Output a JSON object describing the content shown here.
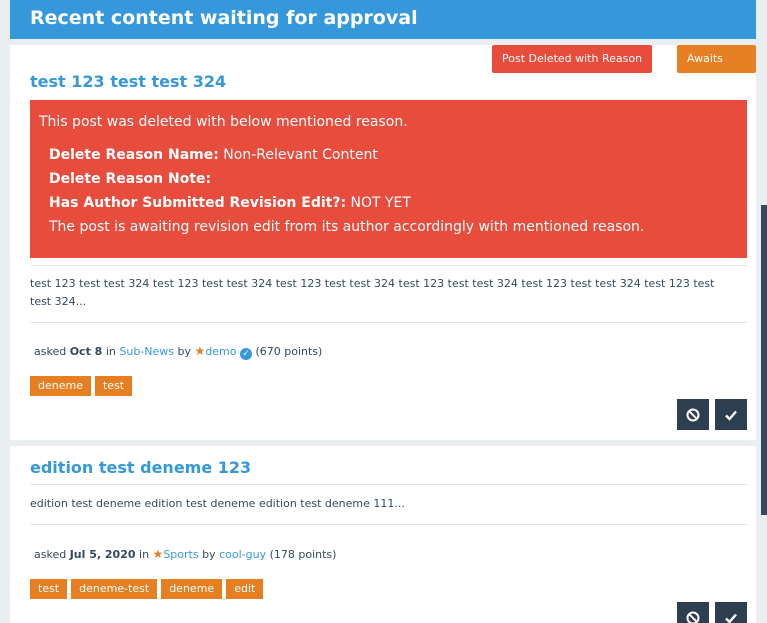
{
  "page": {
    "title": "Recent content waiting for approval"
  },
  "questions": [
    {
      "title": "test 123 test test 324",
      "badges": {
        "deleted": "Post Deleted with Reason",
        "awaits": "Awaits Edit"
      },
      "alert": {
        "intro": "This post was deleted with below mentioned reason.",
        "reason_name_label": "Delete Reason Name:",
        "reason_name_value": " Non-Relevant Content",
        "reason_note_label": "Delete Reason Note:",
        "revision_label": "Has Author Submitted Revision Edit?:",
        "revision_value": " NOT YET",
        "footer": "The post is awaiting revision edit from its author accordingly with mentioned reason."
      },
      "excerpt": "test 123 test test 324 test 123 test test 324 test 123 test test 324 test 123 test test 324 test 123 test test 324 test 123 test test 324...",
      "meta": {
        "asked": "asked",
        "date": "Oct 8",
        "in": "in",
        "category": "Sub-News",
        "by": "by",
        "user": "demo",
        "points": "(670 points)"
      },
      "tags": [
        "deneme",
        "test"
      ]
    },
    {
      "title": "edition test deneme 123",
      "excerpt": "edition test deneme edition test deneme edition test deneme 111...",
      "meta": {
        "asked": "asked",
        "date": "Jul 5, 2020",
        "in": "in",
        "category": "Sports",
        "by": "by",
        "user": "cool-guy",
        "points": "(178 points)"
      },
      "tags": [
        "test",
        "deneme-test",
        "deneme",
        "edit"
      ]
    }
  ],
  "icons": {
    "reject": "ban-icon",
    "approve": "check-icon",
    "star": "star-icon",
    "verified": "verified-icon"
  },
  "colors": {
    "primary": "#3498db",
    "danger": "#e74c3c",
    "warning": "#e67e22",
    "dark": "#2c3e50"
  }
}
